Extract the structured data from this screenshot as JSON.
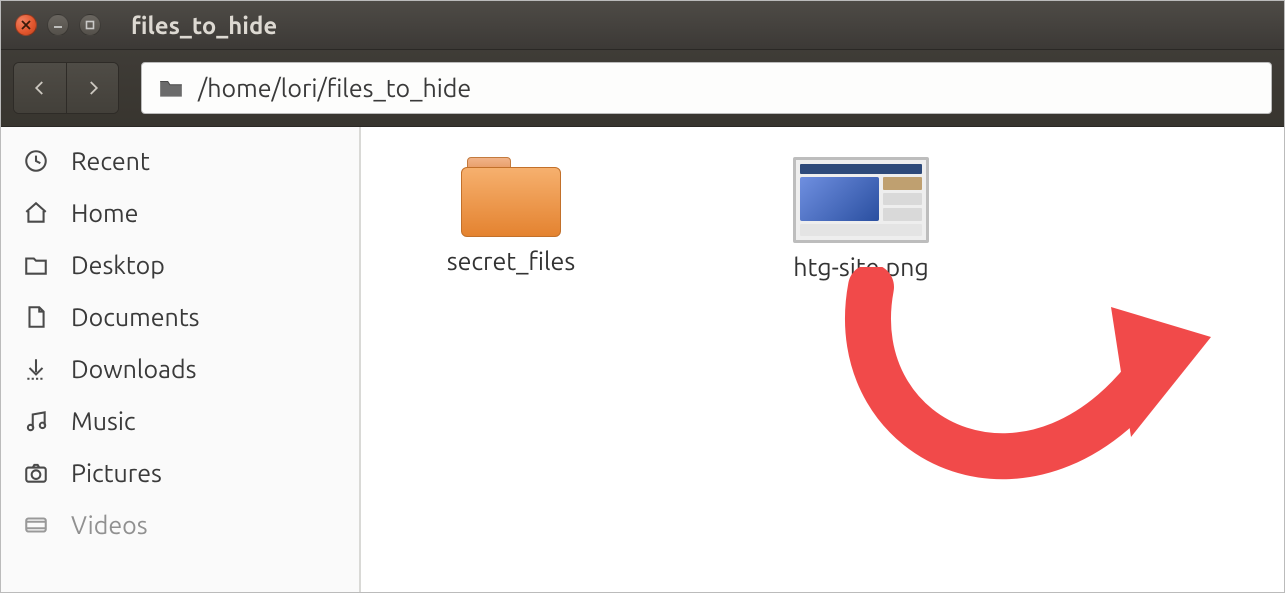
{
  "window": {
    "title": "files_to_hide"
  },
  "toolbar": {
    "path": "/home/lori/files_to_hide"
  },
  "sidebar": {
    "items": [
      {
        "label": "Recent",
        "icon": "clock-icon"
      },
      {
        "label": "Home",
        "icon": "home-icon"
      },
      {
        "label": "Desktop",
        "icon": "desktop-folder-icon"
      },
      {
        "label": "Documents",
        "icon": "document-icon"
      },
      {
        "label": "Downloads",
        "icon": "download-icon"
      },
      {
        "label": "Music",
        "icon": "music-icon"
      },
      {
        "label": "Pictures",
        "icon": "camera-icon"
      },
      {
        "label": "Videos",
        "icon": "video-icon"
      }
    ]
  },
  "content": {
    "items": [
      {
        "name": "secret_files",
        "type": "folder"
      },
      {
        "name": "htg-site.png",
        "type": "image"
      }
    ]
  },
  "annotation": {
    "arrow_color": "#f14a4a"
  }
}
